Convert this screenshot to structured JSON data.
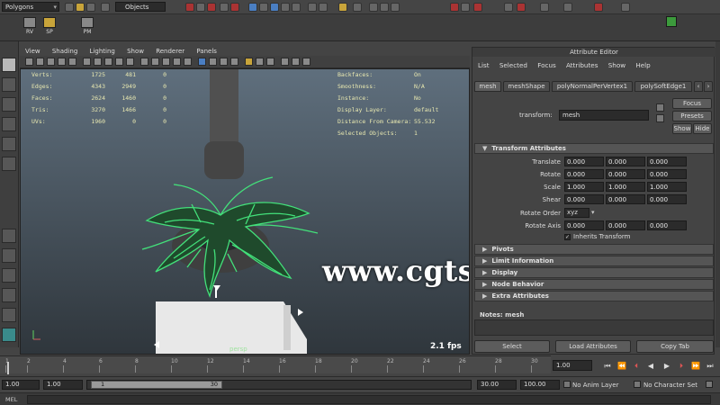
{
  "statusline": {
    "mode": "Polygons",
    "selection_mode": "Objects"
  },
  "shelf": {
    "buttons": [
      "RV",
      "SP",
      "PM"
    ]
  },
  "viewport": {
    "menu": [
      "View",
      "Shading",
      "Lighting",
      "Show",
      "Renderer",
      "Panels"
    ],
    "hud_left": [
      {
        "label": "Verts:",
        "a": "1725",
        "b": "481",
        "c": "0"
      },
      {
        "label": "Edges:",
        "a": "4343",
        "b": "2949",
        "c": "0"
      },
      {
        "label": "Faces:",
        "a": "2624",
        "b": "1460",
        "c": "0"
      },
      {
        "label": "Tris:",
        "a": "3270",
        "b": "1466",
        "c": "0"
      },
      {
        "label": "UVs:",
        "a": "1960",
        "b": "0",
        "c": "0"
      }
    ],
    "hud_right": [
      {
        "label": "Backfaces:",
        "value": "On"
      },
      {
        "label": "Smoothness:",
        "value": "N/A"
      },
      {
        "label": "Instance:",
        "value": "No"
      },
      {
        "label": "Display Layer:",
        "value": "default"
      },
      {
        "label": "Distance From Camera:",
        "value": "55.532"
      },
      {
        "label": "Selected Objects:",
        "value": "1"
      }
    ],
    "camera": "persp",
    "fps": "2.1 fps",
    "watermark": "www.cgtsj.com"
  },
  "attribute_editor": {
    "title": "Attribute Editor",
    "menu": [
      "List",
      "Selected",
      "Focus",
      "Attributes",
      "Show",
      "Help"
    ],
    "tabs": [
      "mesh",
      "meshShape",
      "polyNormalPerVertex1",
      "polySoftEdge1"
    ],
    "transform_label": "transform:",
    "transform_value": "mesh",
    "focus_btn": "Focus",
    "presets_btn": "Presets",
    "show_btn": "Show",
    "hide_btn": "Hide",
    "transform_section": "Transform Attributes",
    "rows": [
      {
        "label": "Translate",
        "values": [
          "0.000",
          "0.000",
          "0.000"
        ]
      },
      {
        "label": "Rotate",
        "values": [
          "0.000",
          "0.000",
          "0.000"
        ]
      },
      {
        "label": "Scale",
        "values": [
          "1.000",
          "1.000",
          "1.000"
        ]
      },
      {
        "label": "Shear",
        "values": [
          "0.000",
          "0.000",
          "0.000"
        ]
      }
    ],
    "rotate_order_label": "Rotate Order",
    "rotate_order_value": "xyz",
    "rotate_axis_label": "Rotate Axis",
    "rotate_axis_values": [
      "0.000",
      "0.000",
      "0.000"
    ],
    "inherits_label": "Inherits Transform",
    "collapsed_sections": [
      "Pivots",
      "Limit Information",
      "Display",
      "Node Behavior",
      "Extra Attributes"
    ],
    "notes_label": "Notes:  mesh",
    "bottom_buttons": [
      "Select",
      "Load Attributes",
      "Copy Tab"
    ]
  },
  "timeline": {
    "ticks": [
      "1",
      "2",
      "4",
      "6",
      "8",
      "10",
      "12",
      "14",
      "16",
      "18",
      "20",
      "22",
      "24",
      "26",
      "28",
      "30"
    ],
    "current_frame": "1.00"
  },
  "range": {
    "start": "1.00",
    "playback_start": "1.00",
    "handle_start": "1",
    "handle_end": "30",
    "playback_end": "30.00",
    "end": "100.00",
    "anim_layer": "No Anim Layer",
    "character_set": "No Character Set"
  },
  "cmdline": {
    "label": "MEL"
  },
  "colors": {
    "wireframe": "#43e07a",
    "hud_text": "#e8e8b0",
    "panel_bg": "#444444"
  }
}
